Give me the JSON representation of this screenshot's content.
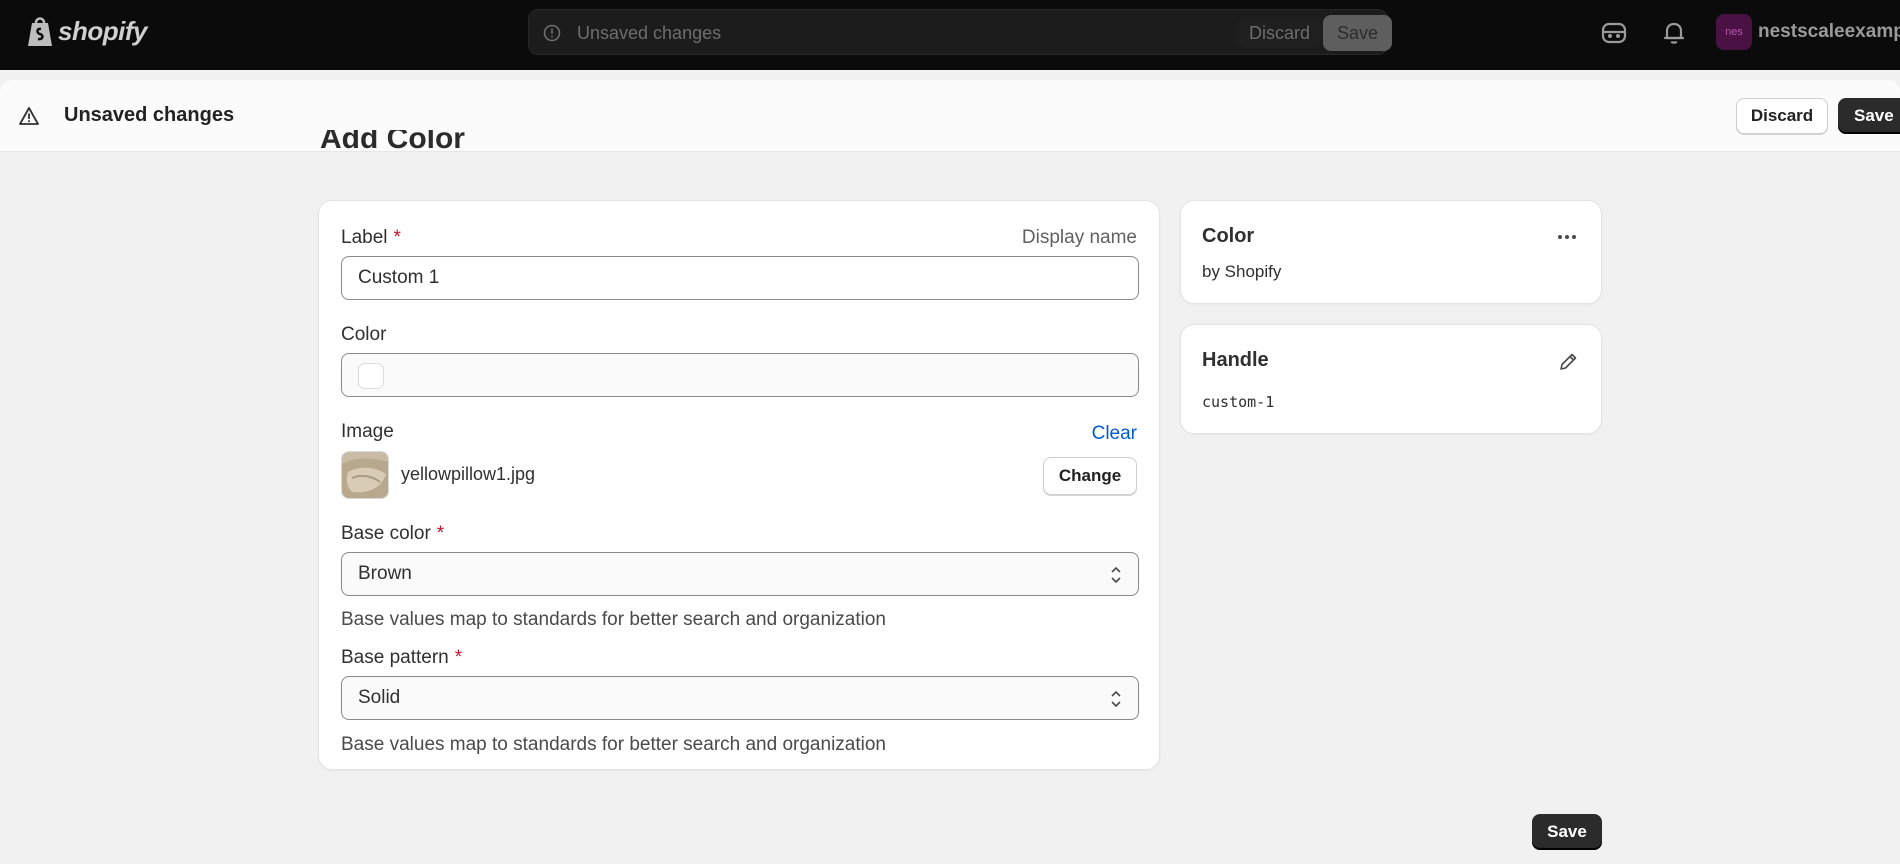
{
  "topbar": {
    "brand": "shopify",
    "save_bar_text": "Unsaved changes",
    "discard_label": "Discard",
    "save_label": "Save",
    "avatar_initials": "nes",
    "store_name": "nestscaleexample"
  },
  "unsaved_bar": {
    "text": "Unsaved changes",
    "discard_label": "Discard",
    "save_label": "Save"
  },
  "page": {
    "title": "Add Color"
  },
  "form": {
    "label_field": {
      "label": "Label",
      "required": "*",
      "aux": "Display name",
      "value": "Custom 1"
    },
    "color_field": {
      "label": "Color",
      "value": ""
    },
    "image_field": {
      "label": "Image",
      "clear_label": "Clear",
      "file_name": "yellowpillow1.jpg",
      "change_label": "Change"
    },
    "base_color": {
      "label": "Base color",
      "required": "*",
      "value": "Brown",
      "help": "Base values map to standards for better search and organization"
    },
    "base_pattern": {
      "label": "Base pattern",
      "required": "*",
      "value": "Solid",
      "help": "Base values map to standards for better search and organization"
    }
  },
  "side": {
    "color_card": {
      "title": "Color",
      "subtitle": "by Shopify"
    },
    "handle_card": {
      "title": "Handle",
      "value": "custom-1"
    }
  },
  "footer": {
    "save_label": "Save"
  },
  "colors": {
    "topbar_bg": "#0b0b0b",
    "page_bg": "#f1f1f1",
    "primary_button": "#2b2b2b",
    "link": "#005bd3",
    "required": "#c4132b",
    "avatar_bg": "#4a1244"
  },
  "icons": {
    "save_bar_alert": "alert-circle-icon",
    "unsaved_warning": "alert-triangle-icon",
    "notifications": "bell-icon",
    "sidekick": "sidekick-icon",
    "more_actions": "horizontal-dots-icon",
    "edit_handle": "pencil-icon",
    "select_arrows": "select-chevrons-icon"
  }
}
